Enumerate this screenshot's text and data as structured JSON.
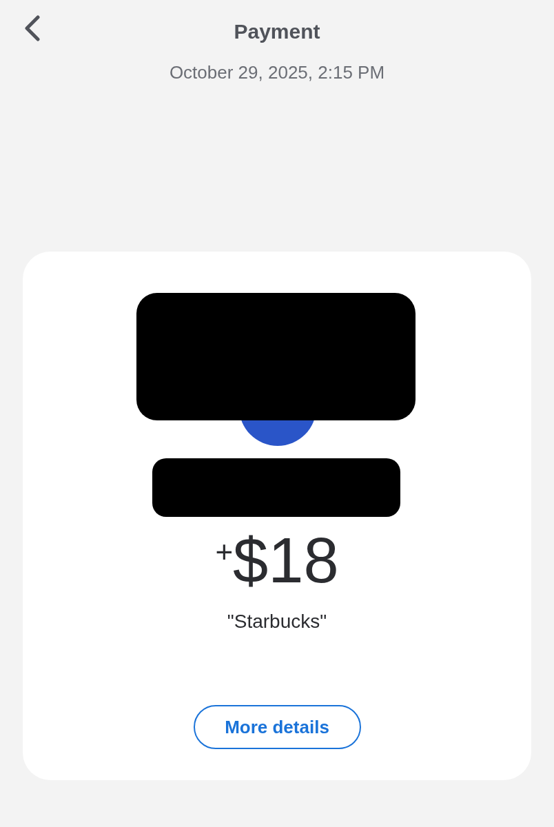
{
  "header": {
    "title": "Payment",
    "date": "October 29, 2025, 2:15 PM"
  },
  "card": {
    "amount": {
      "sign": "+",
      "value": "$18"
    },
    "note": "\"Starbucks\"",
    "button": "More details"
  }
}
